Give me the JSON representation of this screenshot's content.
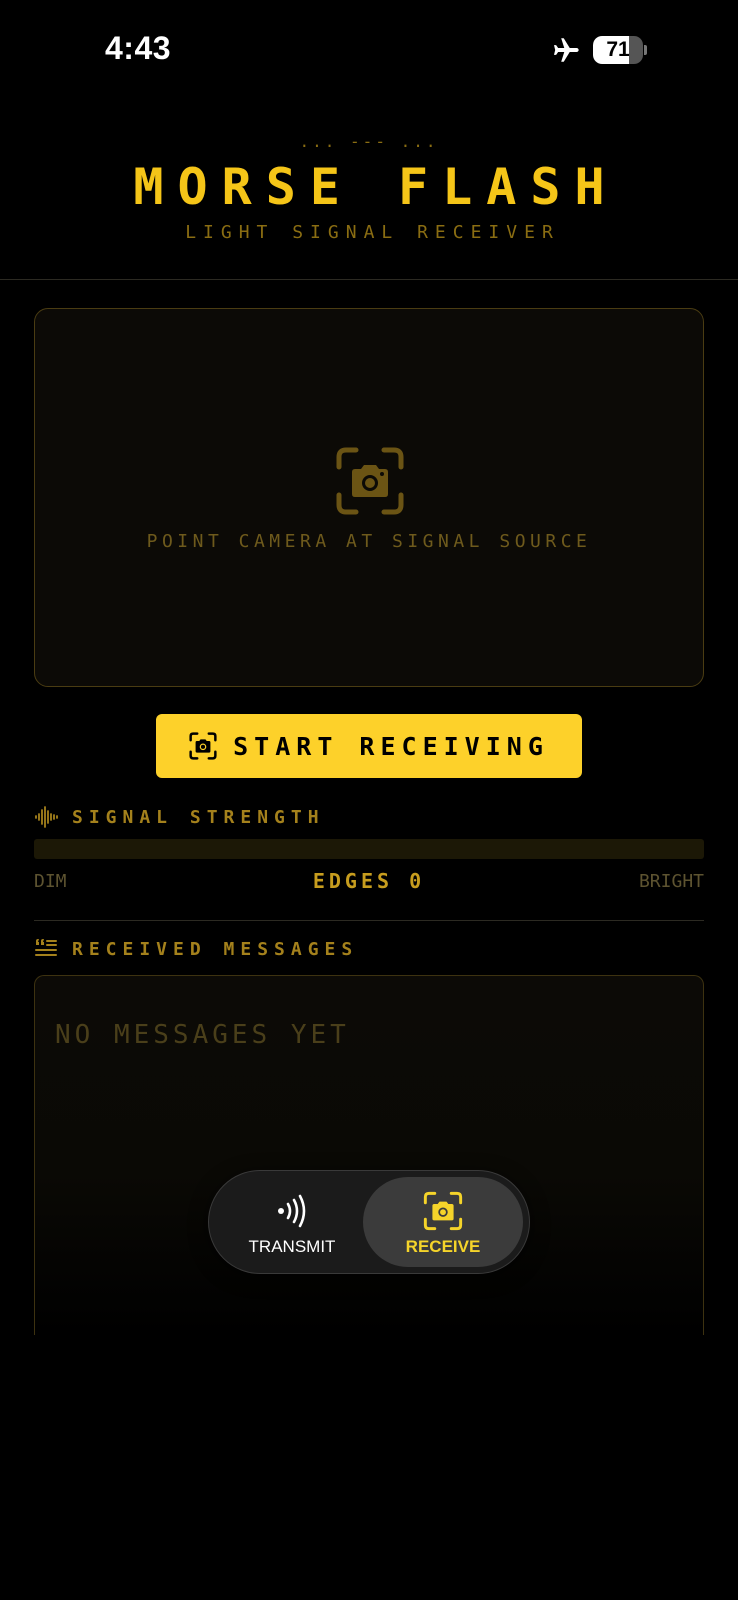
{
  "status_bar": {
    "time": "4:43",
    "battery_percent": "71",
    "battery_level": 0.71,
    "airplane_mode": true,
    "icons": [
      "airplane-icon",
      "battery-icon"
    ]
  },
  "header": {
    "morse_ornament": "... --- ...",
    "title": "MORSE FLASH",
    "subtitle": "LIGHT SIGNAL RECEIVER"
  },
  "camera": {
    "hint": "POINT CAMERA AT SIGNAL SOURCE",
    "icon": "camera-viewfinder-icon"
  },
  "start_button": {
    "label": "START RECEIVING",
    "icon": "camera-viewfinder-icon"
  },
  "signal": {
    "label": "SIGNAL STRENGTH",
    "icon": "waveform-icon",
    "level": 0,
    "dim_label": "DIM",
    "edges_label": "EDGES 0",
    "bright_label": "BRIGHT"
  },
  "messages": {
    "label": "RECEIVED MESSAGES",
    "icon": "quote-list-icon",
    "empty_text": "NO MESSAGES YET"
  },
  "tabs": [
    {
      "label": "TRANSMIT",
      "icon": "broadcast-icon",
      "selected": false
    },
    {
      "label": "RECEIVE",
      "icon": "camera-viewfinder-icon",
      "selected": true
    }
  ],
  "colors": {
    "accent": "#f5c518",
    "button": "#fdd12a",
    "background": "#000000",
    "muted": "#8a6d12",
    "tab_selected": "#f5d42a"
  }
}
